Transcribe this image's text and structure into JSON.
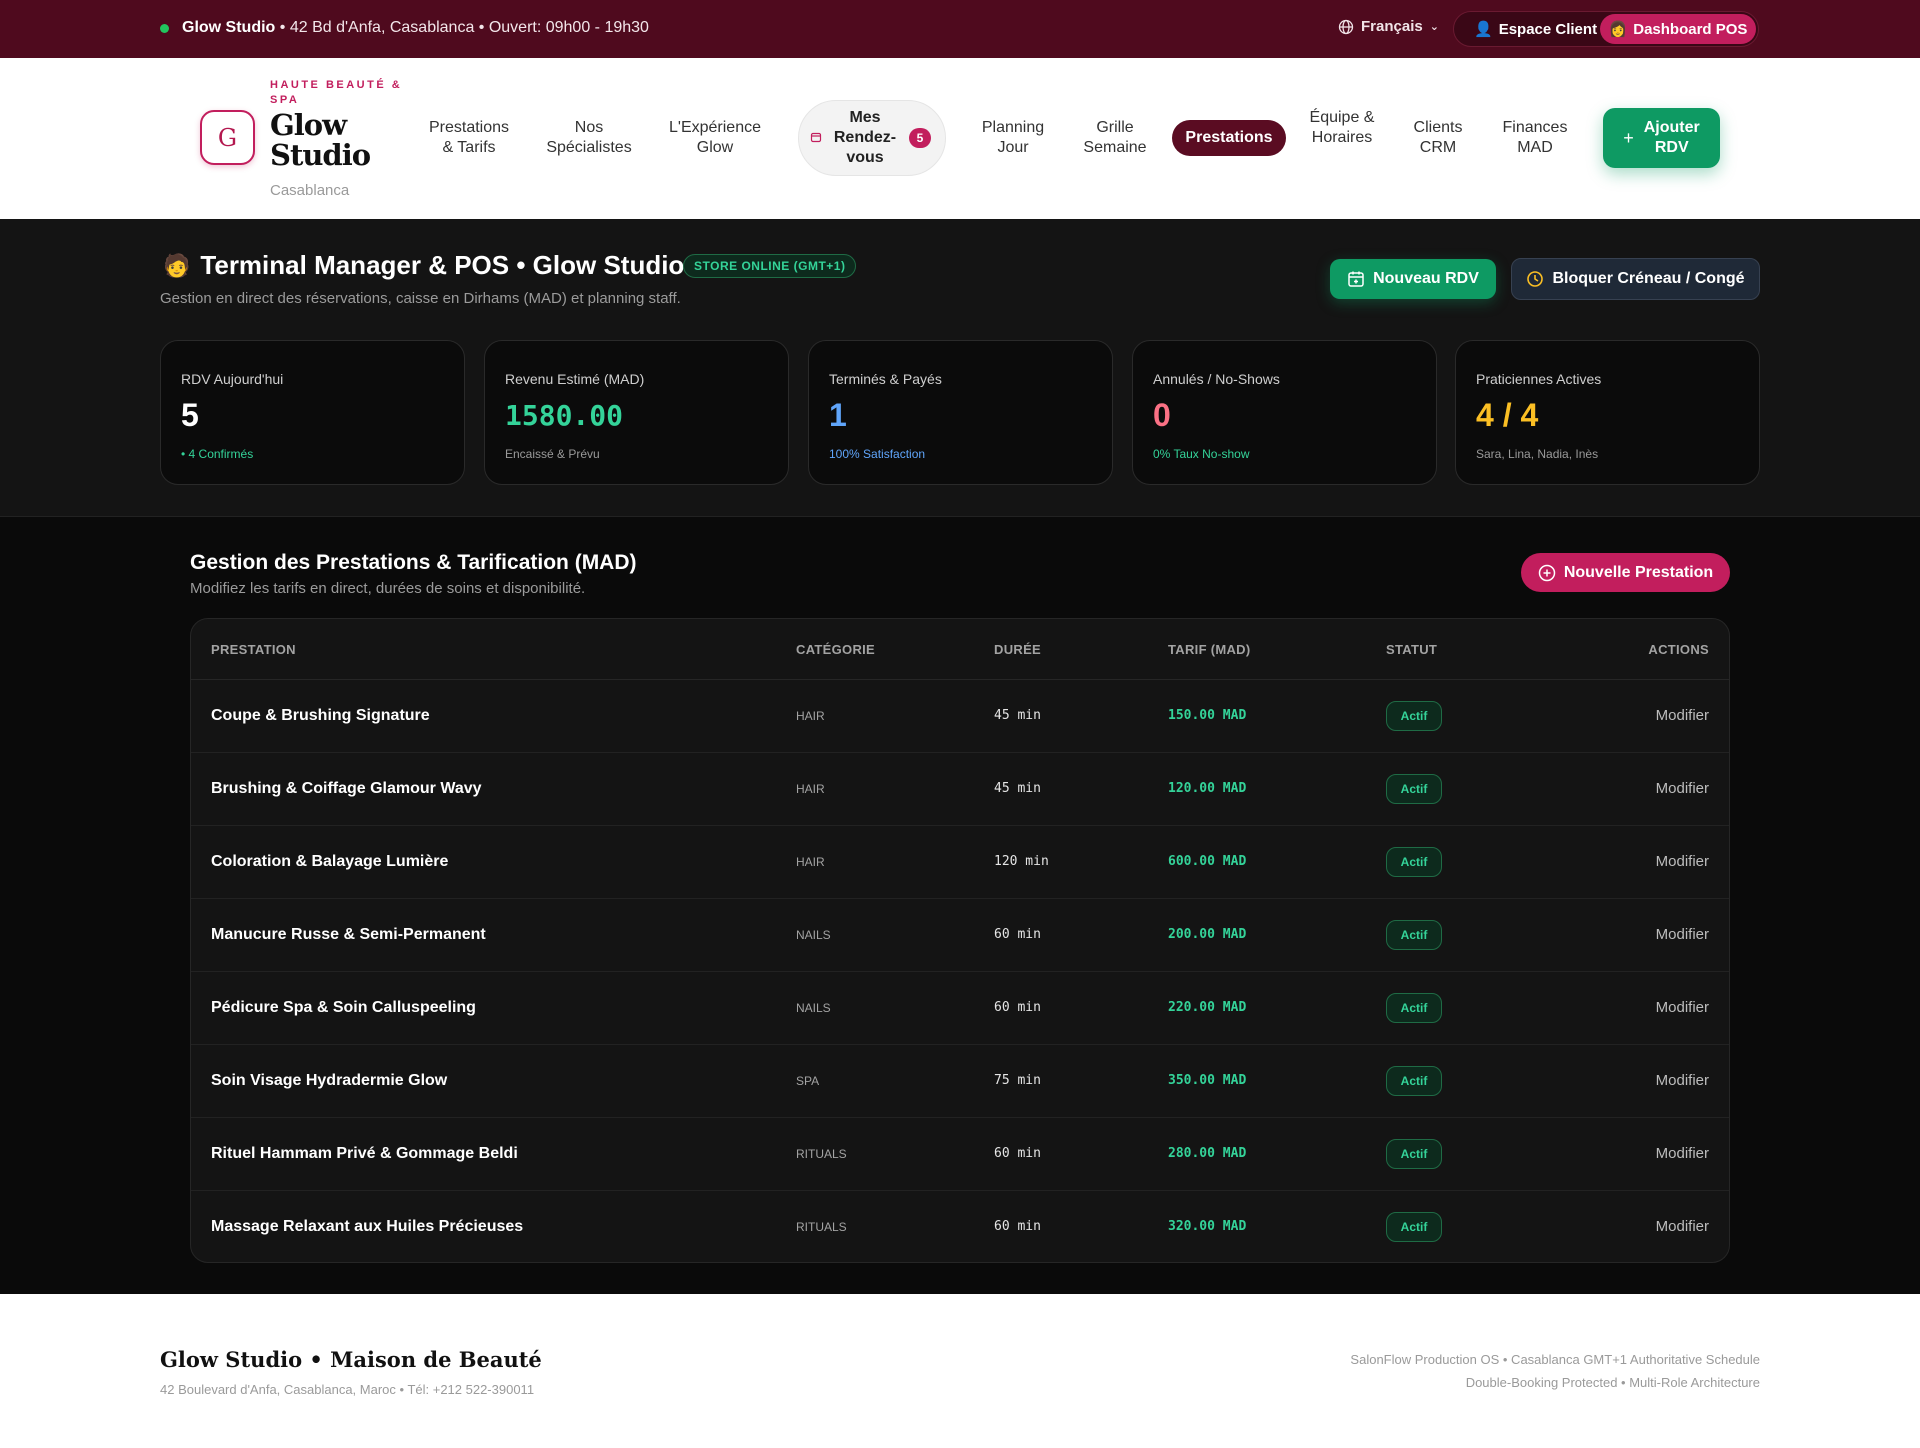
{
  "topbar": {
    "studio": "Glow Studio",
    "details": " • 42 Bd d'Anfa, Casablanca • Ouvert: 09h00 - 19h30",
    "language": "Français",
    "espace_client": "Espace Client",
    "dashboard_pos": "Dashboard POS"
  },
  "brand": {
    "logo_letter": "G",
    "tagline": "HAUTE BEAUTÉ & SPA",
    "name": "Glow Studio",
    "city": "Casablanca"
  },
  "nav": {
    "items": [
      {
        "label": "Prestations & Tarifs"
      },
      {
        "label": "Nos Spécialistes"
      },
      {
        "label": "L'Expérience Glow"
      },
      {
        "label": "Mes Rendez-vous",
        "badge": "5"
      },
      {
        "label": "Planning Jour"
      },
      {
        "label": "Grille Semaine"
      },
      {
        "label": "Prestations",
        "active": true
      },
      {
        "label": "Équipe & Horaires"
      },
      {
        "label": "Clients CRM"
      },
      {
        "label": "Finances MAD"
      }
    ],
    "cta": "Ajouter RDV"
  },
  "hero": {
    "title": "Terminal Manager & POS • Glow Studio",
    "store_badge": "STORE ONLINE (GMT+1)",
    "subtitle": "Gestion en direct des réservations, caisse en Dirhams (MAD) et planning staff.",
    "btn_new_rdv": "Nouveau RDV",
    "btn_block": "Bloquer Créneau / Congé"
  },
  "stats": [
    {
      "label": "RDV Aujourd'hui",
      "value": "5",
      "note": "• 4 Confirmés",
      "value_color": "#ffffff",
      "note_color": "#34d399"
    },
    {
      "label": "Revenu Estimé (MAD)",
      "value": "1580.00",
      "note": "Encaissé & Prévu",
      "value_color": "#34d399",
      "note_color": "#9a9a9a"
    },
    {
      "label": "Terminés & Payés",
      "value": "1",
      "note": "100% Satisfaction",
      "value_color": "#60a5fa",
      "note_color": "#60a5fa"
    },
    {
      "label": "Annulés / No-Shows",
      "value": "0",
      "note": "0% Taux No-show",
      "value_color": "#fb7185",
      "note_color": "#34d399"
    },
    {
      "label": "Praticiennes Actives",
      "value": "4 / 4",
      "note": "Sara, Lina, Nadia, Inès",
      "value_color": "#fbbf24",
      "note_color": "#9a9a9a"
    }
  ],
  "services": {
    "title": "Gestion des Prestations & Tarification (MAD)",
    "subtitle": "Modifiez les tarifs en direct, durées de soins et disponibilité.",
    "btn_new": "Nouvelle Prestation",
    "columns": [
      "PRESTATION",
      "CATÉGORIE",
      "DURÉE",
      "TARIF (MAD)",
      "STATUT",
      "ACTIONS"
    ],
    "rows": [
      {
        "name": "Coupe & Brushing Signature",
        "category": "HAIR",
        "duration": "45 min",
        "price": "150.00 MAD",
        "status": "Actif",
        "action": "Modifier"
      },
      {
        "name": "Brushing & Coiffage Glamour Wavy",
        "category": "HAIR",
        "duration": "45 min",
        "price": "120.00 MAD",
        "status": "Actif",
        "action": "Modifier"
      },
      {
        "name": "Coloration & Balayage Lumière",
        "category": "HAIR",
        "duration": "120 min",
        "price": "600.00 MAD",
        "status": "Actif",
        "action": "Modifier"
      },
      {
        "name": "Manucure Russe & Semi-Permanent",
        "category": "NAILS",
        "duration": "60 min",
        "price": "200.00 MAD",
        "status": "Actif",
        "action": "Modifier"
      },
      {
        "name": "Pédicure Spa & Soin Calluspeeling",
        "category": "NAILS",
        "duration": "60 min",
        "price": "220.00 MAD",
        "status": "Actif",
        "action": "Modifier"
      },
      {
        "name": "Soin Visage Hydradermie Glow",
        "category": "SPA",
        "duration": "75 min",
        "price": "350.00 MAD",
        "status": "Actif",
        "action": "Modifier"
      },
      {
        "name": "Rituel Hammam Privé & Gommage Beldi",
        "category": "RITUALS",
        "duration": "60 min",
        "price": "280.00 MAD",
        "status": "Actif",
        "action": "Modifier"
      },
      {
        "name": "Massage Relaxant aux Huiles Précieuses",
        "category": "RITUALS",
        "duration": "60 min",
        "price": "320.00 MAD",
        "status": "Actif",
        "action": "Modifier"
      }
    ]
  },
  "footer": {
    "title": "Glow Studio • Maison de Beauté",
    "address": "42 Boulevard d'Anfa, Casablanca, Maroc • Tél: +212 522-390011",
    "right_line1": "SalonFlow Production OS • Casablanca GMT+1 Authoritative Schedule",
    "right_line2": "Double-Booking Protected • Multi-Role Architecture"
  },
  "colors": {
    "brand_primary": "#4f0a1e",
    "accent_pink": "#c21e5d",
    "accent_green": "#0e9a63"
  }
}
